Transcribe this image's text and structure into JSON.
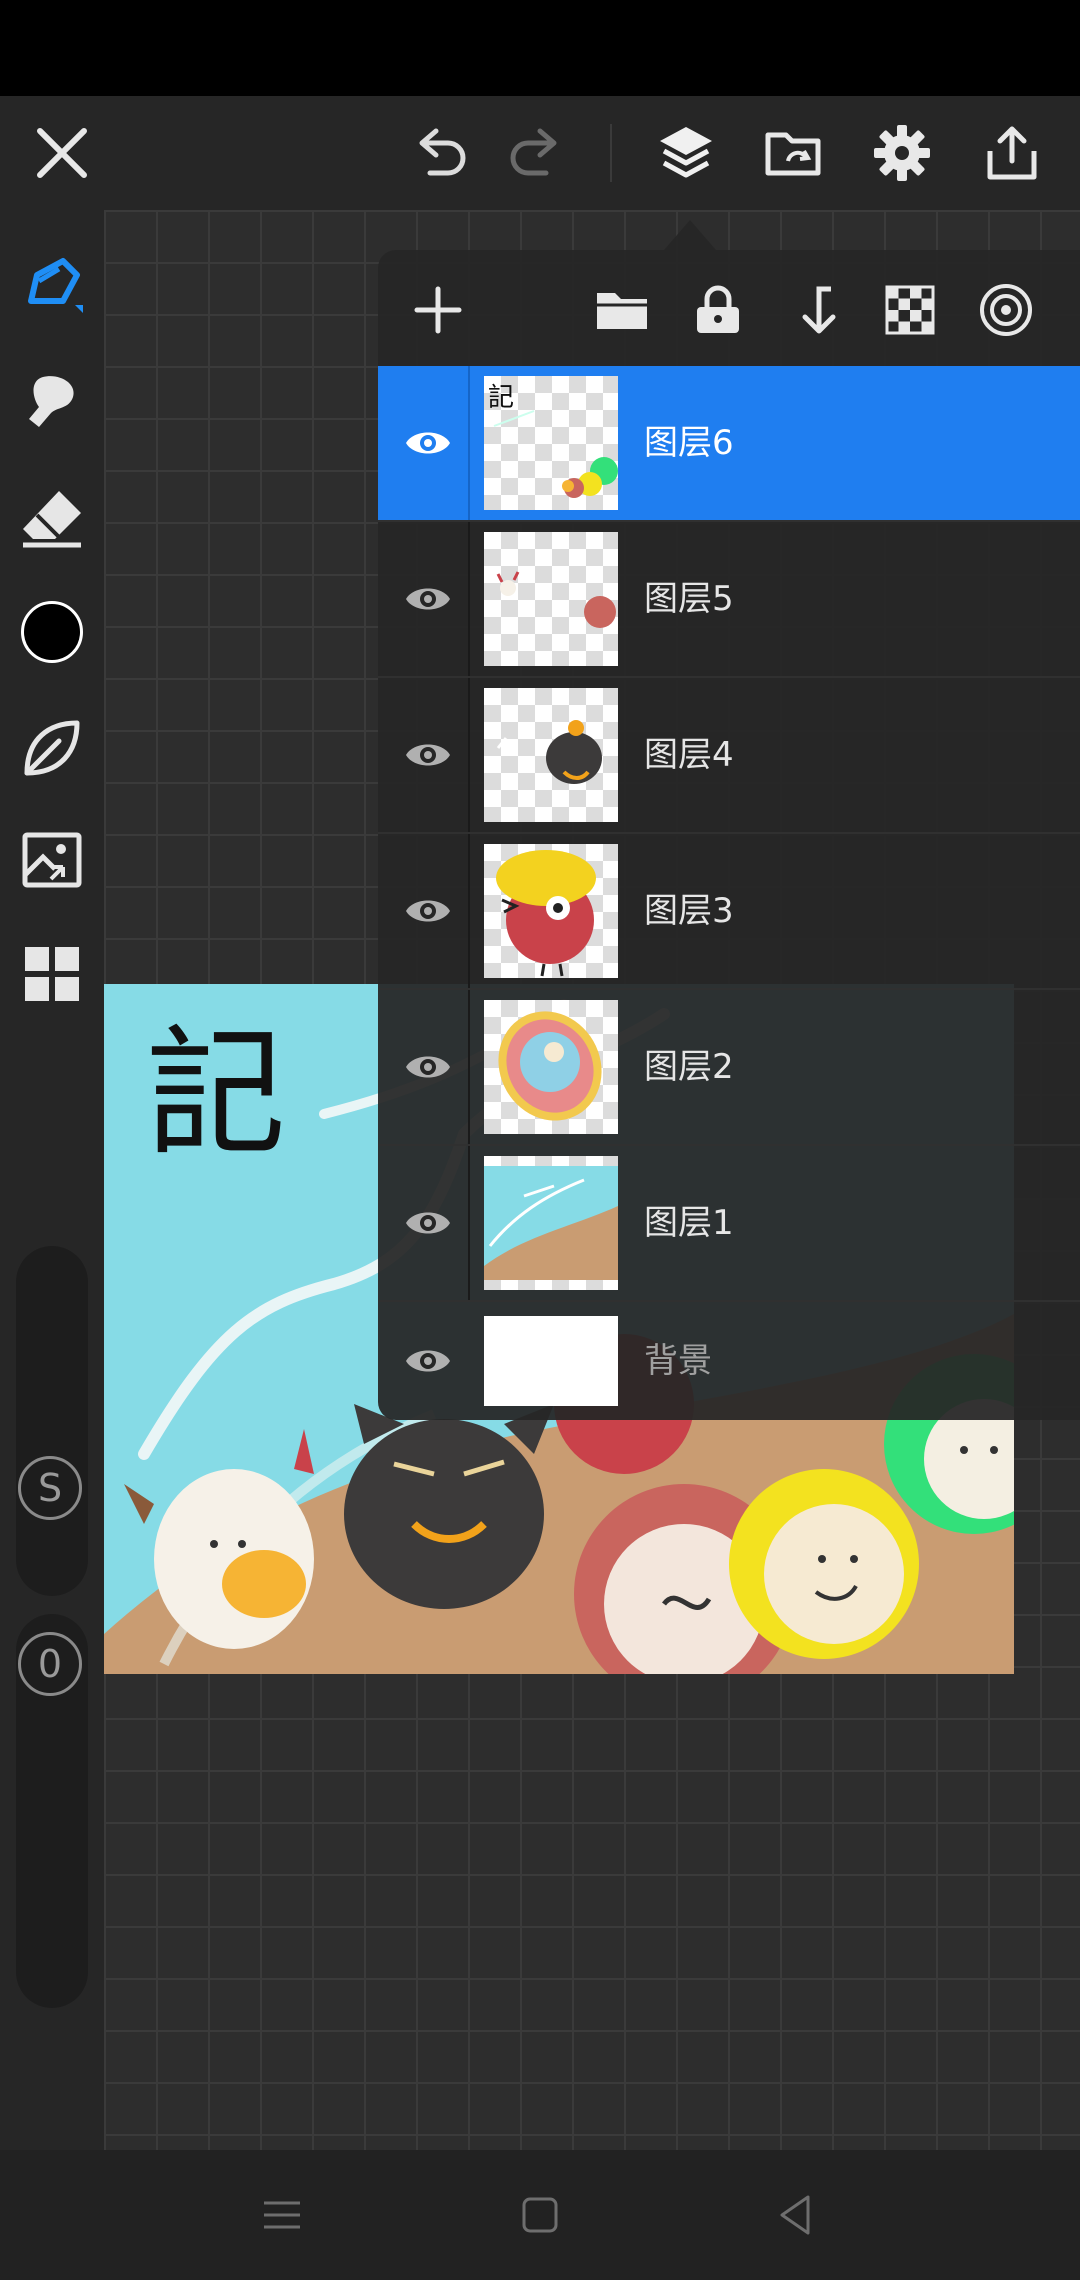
{
  "toolbar": {
    "close": "close-icon",
    "undo": "undo-icon",
    "redo": "redo-icon",
    "layers": "layers-icon",
    "gallery": "gallery-sync-icon",
    "settings": "gear-icon",
    "share": "share-icon"
  },
  "sidebar": {
    "tools": [
      "pen-brush-icon",
      "smudge-icon",
      "eraser-icon",
      "color-swatch",
      "leaf-icon",
      "image-icon",
      "grid-icon"
    ],
    "color": "#000000",
    "size_slider_label": "S",
    "opacity_slider_label": "0"
  },
  "layer_panel": {
    "tools": [
      "add-layer-icon",
      "folder-icon",
      "lock-icon",
      "merge-down-icon",
      "checker-icon",
      "target-icon"
    ],
    "layers": [
      {
        "name": "图层6",
        "visible": true,
        "selected": true
      },
      {
        "name": "图层5",
        "visible": true,
        "selected": false
      },
      {
        "name": "图层4",
        "visible": true,
        "selected": false
      },
      {
        "name": "图层3",
        "visible": true,
        "selected": false
      },
      {
        "name": "图层2",
        "visible": true,
        "selected": false
      },
      {
        "name": "图层1",
        "visible": true,
        "selected": false
      },
      {
        "name": "背景",
        "visible": true,
        "selected": false
      }
    ]
  },
  "artwork": {
    "calligraphy": "記"
  },
  "navbar": {
    "buttons": [
      "menu-icon",
      "home-icon",
      "back-icon"
    ]
  },
  "colors": {
    "accent": "#1f7ef0",
    "toolbar_bg": "#262626",
    "canvas_bg": "#2d2d2d"
  }
}
